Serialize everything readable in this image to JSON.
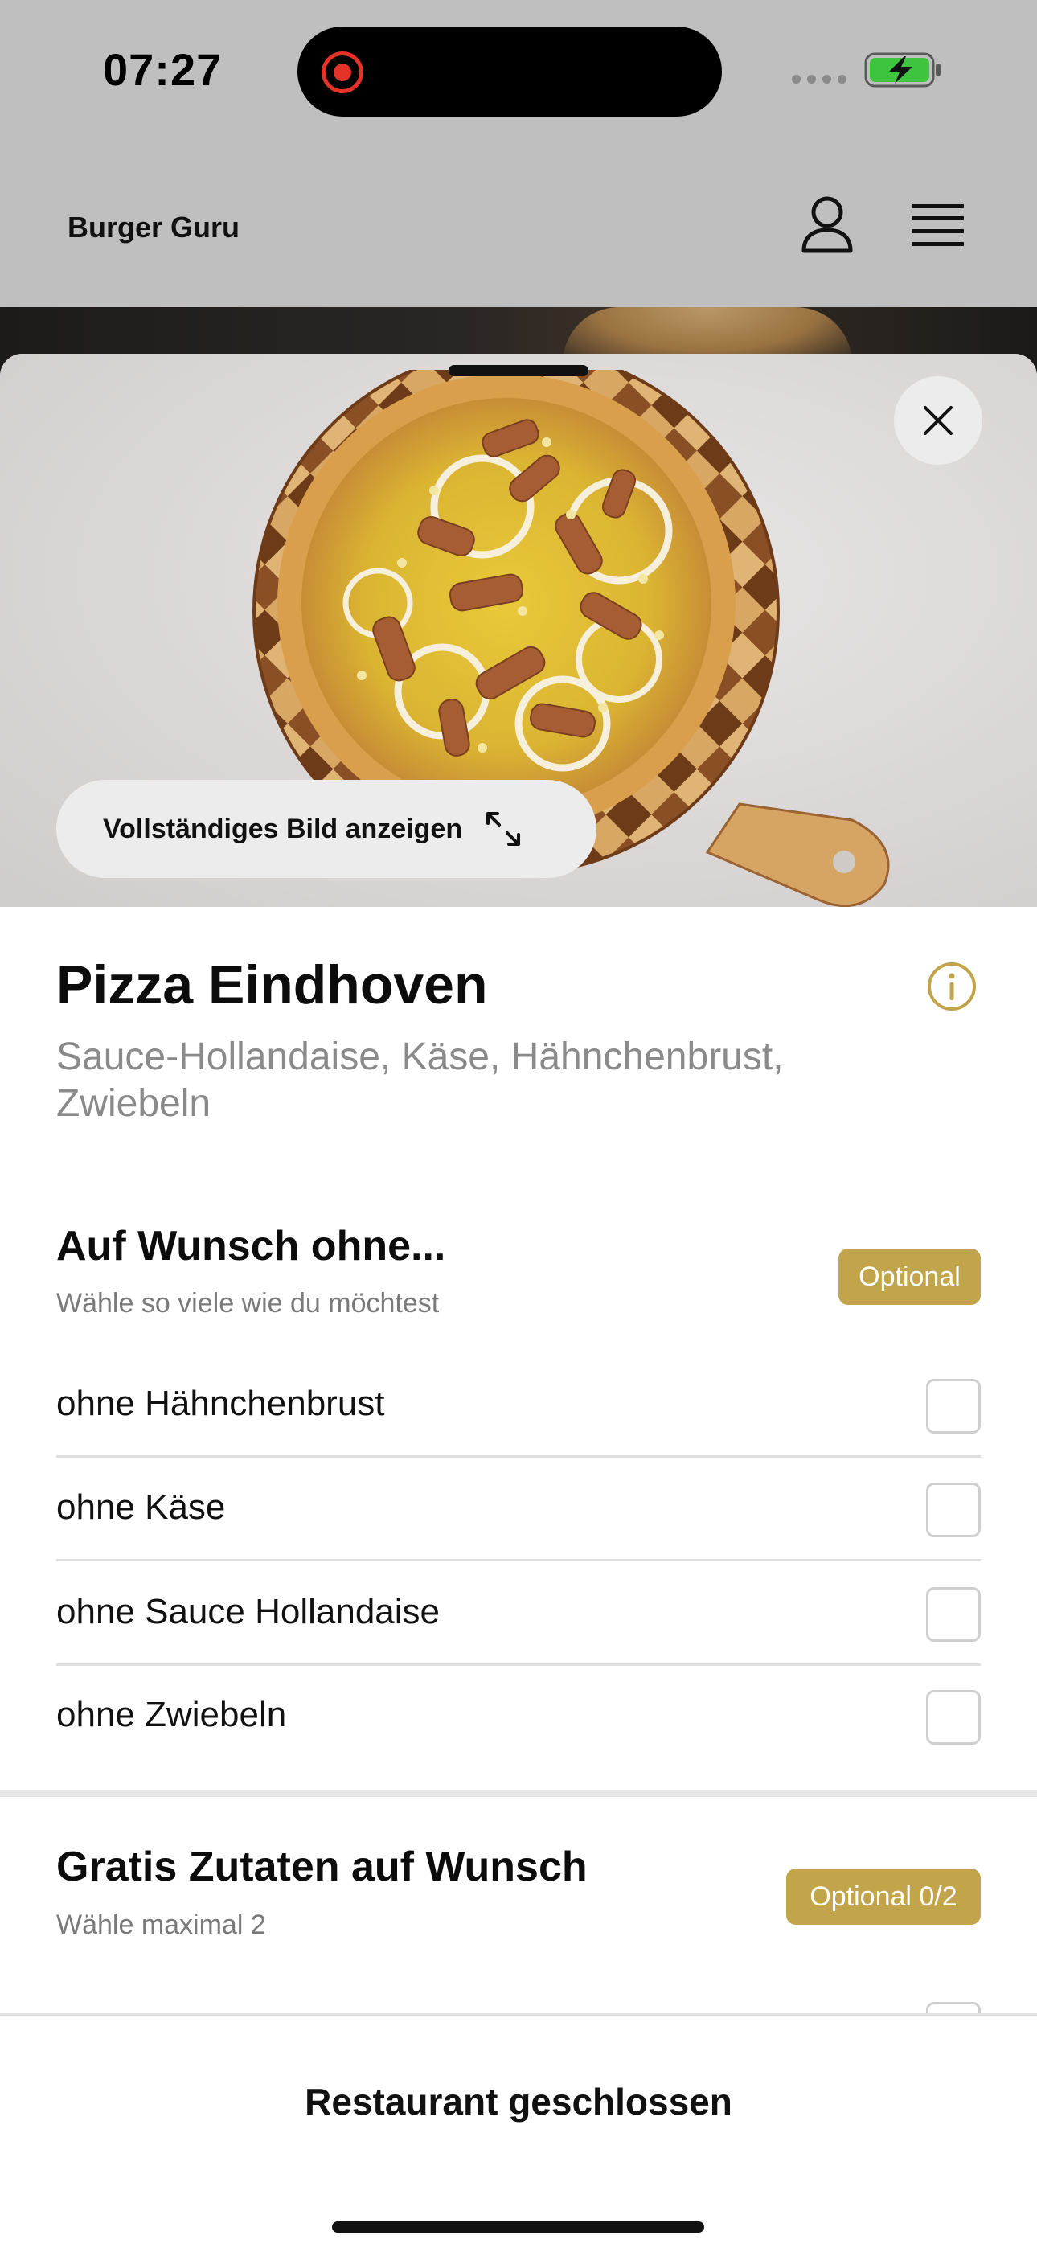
{
  "status_bar": {
    "time": "07:27",
    "recording_icon": "screen-recording-icon",
    "signal_icon": "cellular-signal-icon",
    "battery_icon": "battery-charging-icon",
    "battery_color": "#3ec43e"
  },
  "header": {
    "brand": "Burger Guru",
    "profile_icon": "user-profile-icon",
    "menu_icon": "hamburger-menu-icon"
  },
  "hero": {
    "full_image_label": "Vollständiges Bild anzeigen",
    "expand_icon": "expand-arrows-icon",
    "close_icon": "close-icon"
  },
  "product": {
    "title": "Pizza Eindhoven",
    "description": "Sauce-Hollandaise, Käse, Hähnchenbrust, Zwiebeln",
    "info_icon": "info-icon"
  },
  "group_without": {
    "title": "Auf Wunsch ohne...",
    "subtitle": "Wähle so viele wie du möchtest",
    "badge": "Optional",
    "options": [
      {
        "label": "ohne Hähnchenbrust",
        "checked": false
      },
      {
        "label": "ohne Käse",
        "checked": false
      },
      {
        "label": "ohne Sauce Hollandaise",
        "checked": false
      },
      {
        "label": "ohne Zwiebeln",
        "checked": false
      }
    ]
  },
  "group_free": {
    "title": "Gratis Zutaten auf Wunsch",
    "subtitle": "Wähle maximal 2",
    "badge": "Optional 0/2"
  },
  "footer": {
    "status": "Restaurant geschlossen"
  },
  "colors": {
    "accent": "#c2a44a",
    "header_bg": "#bfbfbf"
  }
}
